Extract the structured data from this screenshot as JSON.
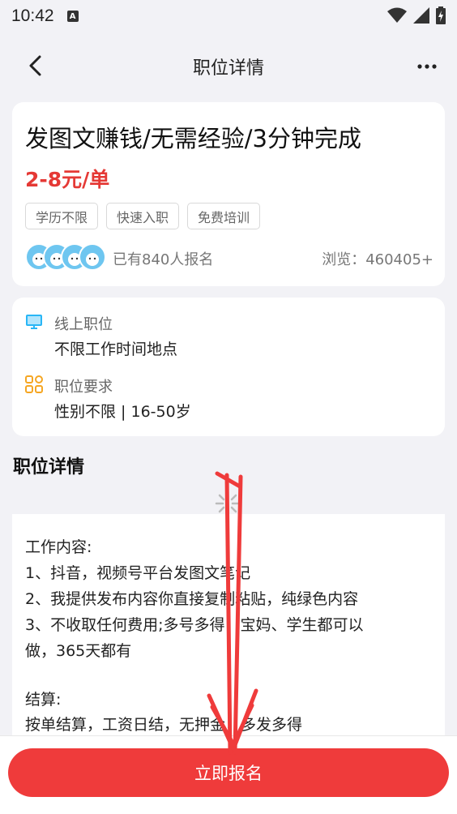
{
  "status_bar": {
    "time": "10:42",
    "notification_icon": "A"
  },
  "nav": {
    "title": "职位详情"
  },
  "job": {
    "title": "发图文赚钱/无需经验/3分钟完成",
    "pay": "2-8元/单",
    "tags": [
      "学历不限",
      "快速入职",
      "免费培训"
    ],
    "enrolled": "已有840人报名",
    "views": "浏览：460405+"
  },
  "info": {
    "location_label": "线上职位",
    "location_value": "不限工作时间地点",
    "requirement_label": "职位要求",
    "requirement_value": "性别不限 | 16-50岁"
  },
  "detail": {
    "section_title": "职位详情",
    "lines": [
      "工作内容:",
      "1、抖音，视频号平台发图文笔记",
      "2、我提供发布内容你直接复制粘贴，纯绿色内容",
      "3、不收取任何费用;多号多得，宝妈、学生都可以",
      "做，365天都有",
      "",
      "结算:",
      "按单结算，工资日结，无押金，多发多得"
    ]
  },
  "bottom": {
    "apply_label": "立即报名"
  },
  "colors": {
    "accent": "#ef3b3b",
    "pay": "#e53935",
    "monitor_icon": "#29b6f6",
    "grid_icon": "#f5a623"
  }
}
